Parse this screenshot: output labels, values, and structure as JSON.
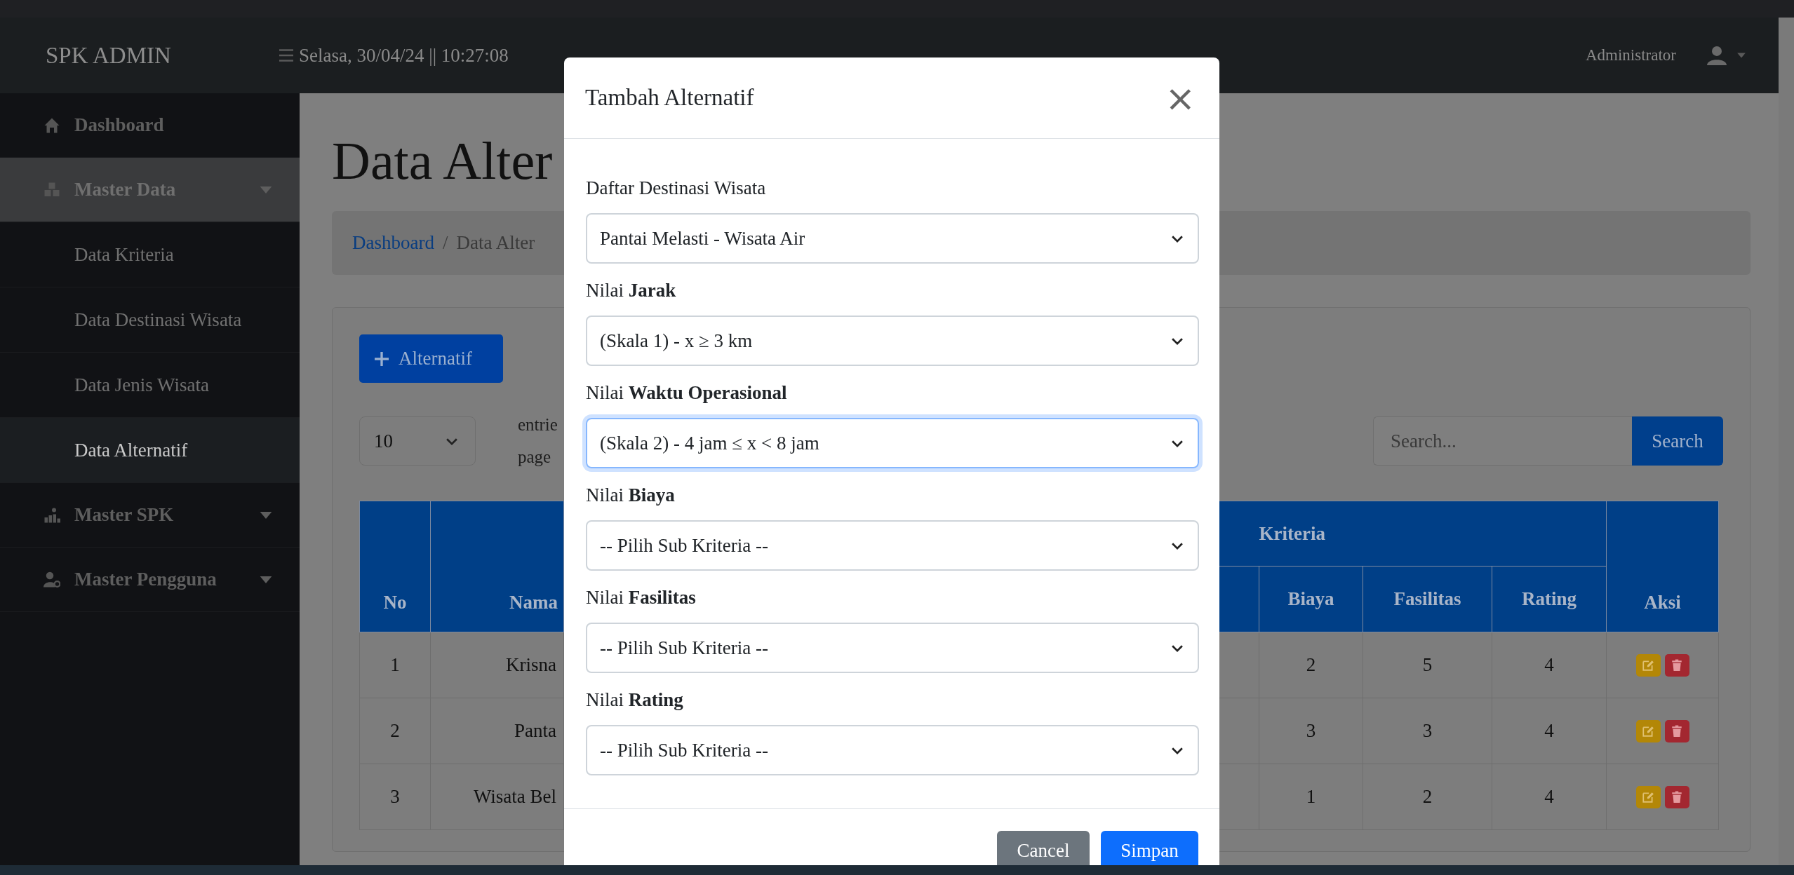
{
  "header": {
    "brand": "SPK ADMIN",
    "datetime": "Selasa, 30/04/24 || 10:27:08",
    "user": "Administrator"
  },
  "sidebar": {
    "items": [
      {
        "label": "Dashboard",
        "kind": "link",
        "selected": false
      },
      {
        "label": "Master Data",
        "kind": "group",
        "expanded": true,
        "children": [
          {
            "label": "Data Kriteria",
            "selected": false
          },
          {
            "label": "Data Destinasi Wisata",
            "selected": false
          },
          {
            "label": "Data Jenis Wisata",
            "selected": false
          },
          {
            "label": "Data Alternatif",
            "selected": true
          }
        ]
      },
      {
        "label": "Master SPK",
        "kind": "group",
        "expanded": false
      },
      {
        "label": "Master Pengguna",
        "kind": "group",
        "expanded": false
      }
    ]
  },
  "page": {
    "title": "Data Alter",
    "breadcrumb_separator": "/",
    "breadcrumb": [
      {
        "label": "Dashboard",
        "kind": "link"
      },
      {
        "label": "Data Alter",
        "kind": "current"
      }
    ],
    "add_button": "Alternatif",
    "length_select": {
      "value": "10"
    },
    "length_label": [
      "entrie",
      "page"
    ],
    "search": {
      "placeholder": "Search...",
      "button": "Search"
    },
    "table": {
      "columns": {
        "no": "No",
        "name": "Nama",
        "group": "Kriteria",
        "criteria": [
          "Biaya",
          "Fasilitas",
          "Rating"
        ],
        "actions": "Aksi"
      },
      "rows": [
        {
          "no": "1",
          "name": "Krisna",
          "values": [
            "2",
            "5",
            "4"
          ]
        },
        {
          "no": "2",
          "name": "Panta",
          "values": [
            "3",
            "3",
            "4"
          ]
        },
        {
          "no": "3",
          "name": "Wisata Bel",
          "values": [
            "1",
            "2",
            "4"
          ]
        }
      ]
    }
  },
  "modal": {
    "title": "Tambah Alternatif",
    "close": "×",
    "fields": [
      {
        "label": "Daftar Destinasi Wisata",
        "value": "Pantai Melasti - Wisata Air",
        "focused": false
      },
      {
        "label": "Nilai **Jarak**",
        "value": "(Skala 1) - x ≥ 3 km",
        "focused": false
      },
      {
        "label": "Nilai **Waktu Operasional**",
        "value": "(Skala 2) - 4 jam ≤ x < 8 jam",
        "focused": true
      },
      {
        "label": "Nilai **Biaya**",
        "value": "-- Pilih Sub Kriteria --",
        "focused": false
      },
      {
        "label": "Nilai **Fasilitas**",
        "value": "-- Pilih Sub Kriteria --",
        "focused": false
      },
      {
        "label": "Nilai **Rating**",
        "value": "-- Pilih Sub Kriteria --",
        "focused": false
      }
    ],
    "buttons": [
      {
        "label": "Cancel",
        "kind": "secondary"
      },
      {
        "label": "Simpan",
        "kind": "primary"
      }
    ]
  }
}
